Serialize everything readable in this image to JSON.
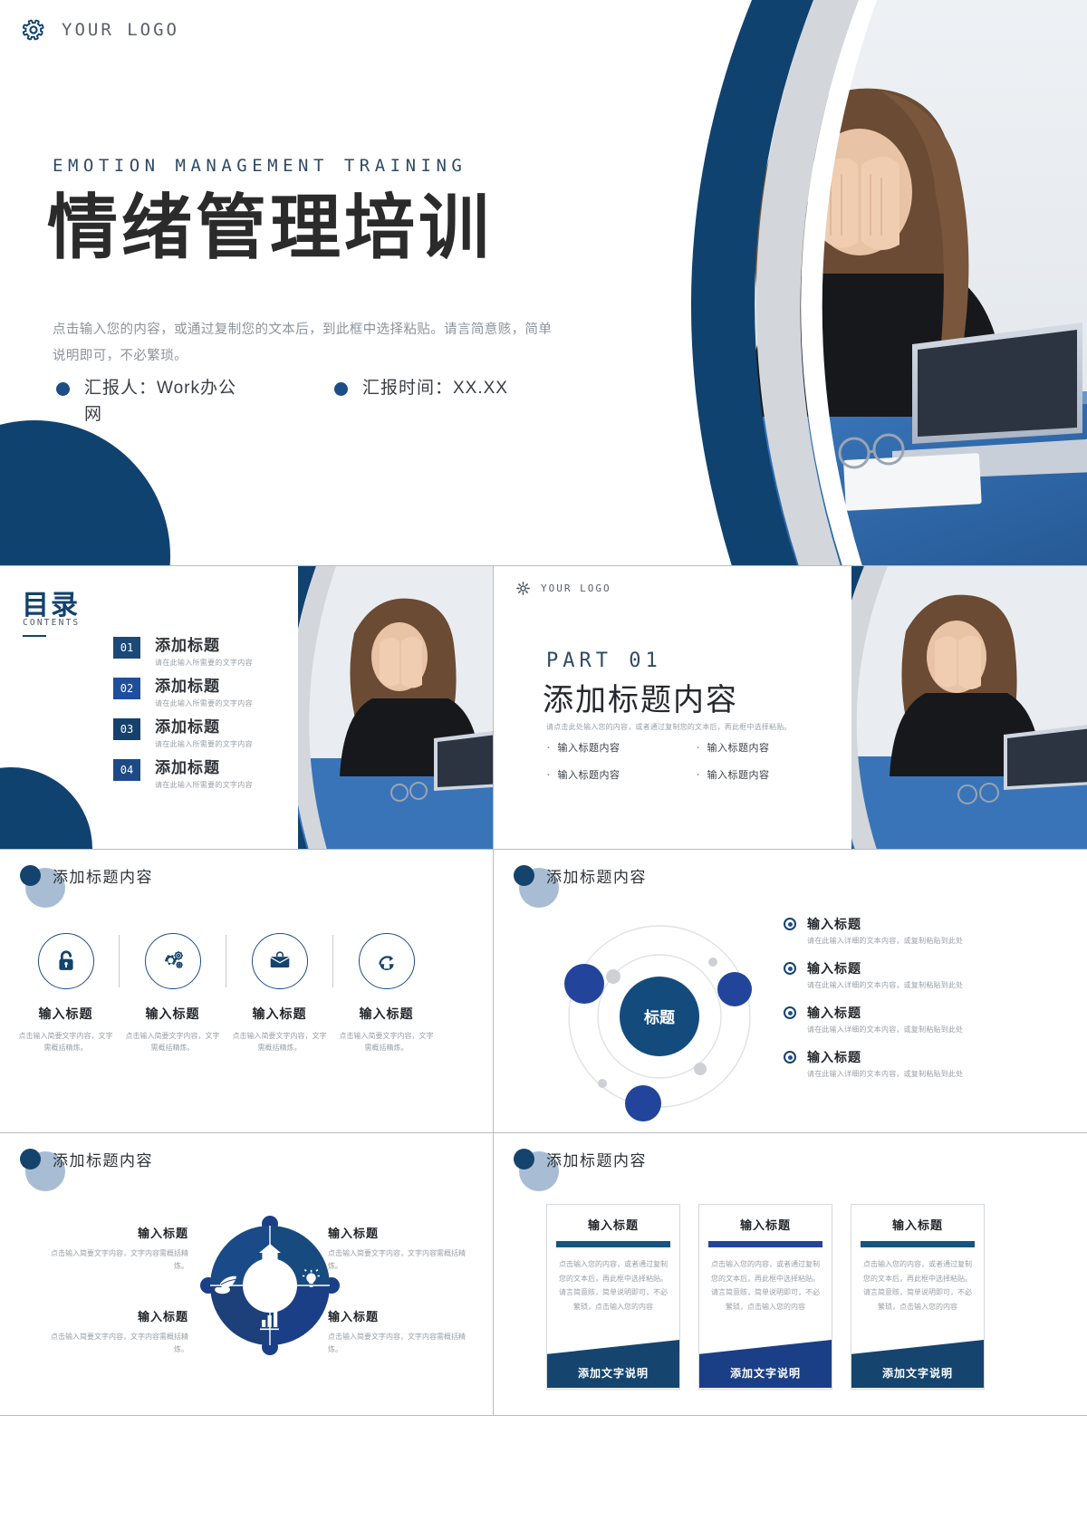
{
  "brand": {
    "navy": "#10426f",
    "blue": "#1f4f9c",
    "steel": "#2f4b63",
    "slate_blob": "#a8bdd3",
    "muted_text": "#9aa0a6",
    "logo_text": "YOUR LOGO",
    "logo_icon": "gear-icon"
  },
  "hero": {
    "eyebrow": "EMOTION MANAGEMENT TRAINING",
    "title": "情绪管理培训",
    "lede": "点击输入您的内容，或通过复制您的文本后，到此框中选择粘贴。请言简意赅，简单说明即可，不必繁琐。",
    "meta": [
      {
        "label": "汇报人：Work办公网"
      },
      {
        "label": "汇报时间：XX.XX"
      }
    ],
    "photo_alt": "stressed-woman-at-laptop-photo"
  },
  "toc": {
    "title": "目录",
    "subtitle": "CONTENTS",
    "items": [
      {
        "num": "01",
        "heading": "添加标题",
        "desc": "请在此输入所需要的文字内容"
      },
      {
        "num": "02",
        "heading": "添加标题",
        "desc": "请在此输入所需要的文字内容"
      },
      {
        "num": "03",
        "heading": "添加标题",
        "desc": "请在此输入所需要的文字内容"
      },
      {
        "num": "04",
        "heading": "添加标题",
        "desc": "请在此输入所需要的文字内容"
      }
    ]
  },
  "part": {
    "label": "PART 01",
    "title": "添加标题内容",
    "lede": "请点击此处输入您的内容，或者通过复制您的文本后，再此框中选择粘贴。",
    "bullets": [
      "输入标题内容",
      "输入标题内容",
      "输入标题内容",
      "输入标题内容"
    ]
  },
  "icons_slide": {
    "section_title": "添加标题内容",
    "items": [
      {
        "icon": "lock-icon",
        "heading": "输入标题",
        "desc": "点击输入简要文字内容，文字需概括精炼。"
      },
      {
        "icon": "gears-icon",
        "heading": "输入标题",
        "desc": "点击输入简要文字内容，文字需概括精炼。"
      },
      {
        "icon": "briefcase-icon",
        "heading": "输入标题",
        "desc": "点击输入简要文字内容，文字需概括精炼。"
      },
      {
        "icon": "people-arrow-icon",
        "heading": "输入标题",
        "desc": "点击输入简要文字内容，文字需概括精炼。"
      }
    ]
  },
  "orbit_slide": {
    "section_title": "添加标题内容",
    "center_label": "标题",
    "items": [
      {
        "heading": "输入标题",
        "desc": "请在此输入详细的文本内容，或复制粘贴到此处"
      },
      {
        "heading": "输入标题",
        "desc": "请在此输入详细的文本内容，或复制粘贴到此处"
      },
      {
        "heading": "输入标题",
        "desc": "请在此输入详细的文本内容，或复制粘贴到此处"
      },
      {
        "heading": "输入标题",
        "desc": "请在此输入详细的文本内容，或复制粘贴到此处"
      }
    ]
  },
  "donut_slide": {
    "section_title": "添加标题内容",
    "segments": [
      {
        "icon": "home-icon",
        "heading": "输入标题",
        "desc": "点击输入简要文字内容，文字内容需概括精炼。"
      },
      {
        "icon": "bulb-icon",
        "heading": "输入标题",
        "desc": "点击输入简要文字内容，文字内容需概括精炼。"
      },
      {
        "icon": "bar-chart-icon",
        "heading": "输入标题",
        "desc": "点击输入简要文字内容，文字内容需概括精炼。"
      },
      {
        "icon": "leaf-hand-icon",
        "heading": "输入标题",
        "desc": "点击输入简要文字内容，文字内容需概括精炼。"
      }
    ]
  },
  "cards_slide": {
    "section_title": "添加标题内容",
    "cards": [
      {
        "heading": "输入标题",
        "body": "点击输入您的内容，或者通过复制您的文本后，再此框中选择粘贴。请言简意赅，简单说明即可，不必繁琐，点击输入您的内容",
        "footer": "添加文字说明"
      },
      {
        "heading": "输入标题",
        "body": "点击输入您的内容，或者通过复制您的文本后，再此框中选择粘贴。请言简意赅，简单说明即可，不必繁琐，点击输入您的内容",
        "footer": "添加文字说明"
      },
      {
        "heading": "输入标题",
        "body": "点击输入您的内容，或者通过复制您的文本后，再此框中选择粘贴。请言简意赅，简单说明即可，不必繁琐，点击输入您的内容",
        "footer": "添加文字说明"
      }
    ]
  }
}
